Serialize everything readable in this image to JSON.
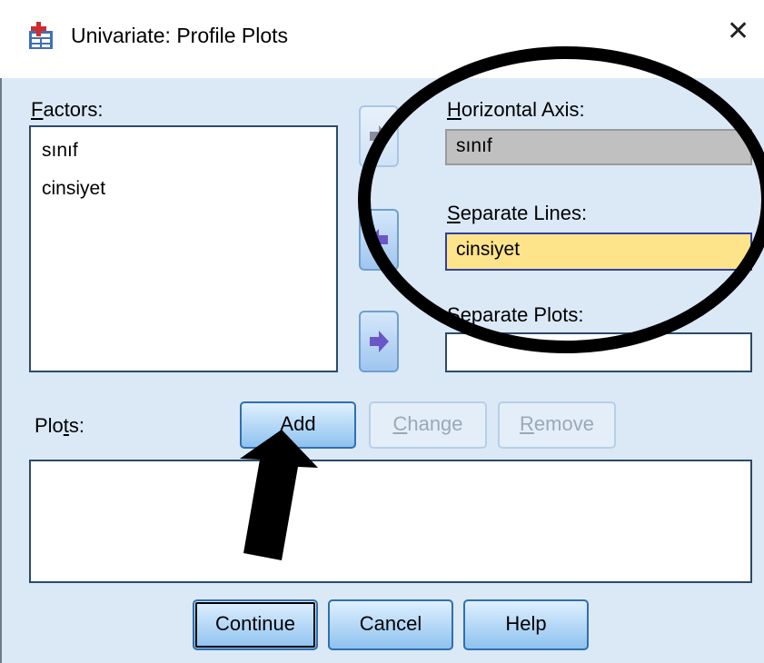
{
  "window": {
    "title": "Univariate: Profile Plots",
    "close_glyph": "✕"
  },
  "factors": {
    "label_ul": "F",
    "label_rest": "actors:",
    "items": [
      "sınıf",
      "cinsiyet"
    ]
  },
  "horizontal_axis": {
    "label_ul": "H",
    "label_rest": "orizontal Axis:",
    "value": "sınıf"
  },
  "separate_lines": {
    "label_ul": "S",
    "label_rest": "eparate Lines:",
    "value": "cinsiyet"
  },
  "separate_plots": {
    "label_ul": "S",
    "label_rest": "eparate Plots:",
    "value": ""
  },
  "plots": {
    "label_pre": "Plo",
    "label_ul": "t",
    "label_rest": "s:"
  },
  "buttons": {
    "add": "Add",
    "change_ul": "C",
    "change_rest": "hange",
    "remove_ul": "R",
    "remove_rest": "emove",
    "continue": "Continue",
    "cancel": "Cancel",
    "help": "Help"
  },
  "colors": {
    "dialog_bg": "#dbe9f7",
    "horizontal_axis_field_bg": "#c0c0c0",
    "separate_lines_field_bg": "#fde38a",
    "arrow_purple": "#6b56c8",
    "annotation": "#000000"
  },
  "icons": {
    "app": "spss-dialog-icon",
    "arrow_right": "arrow-right-icon",
    "arrow_left": "arrow-left-icon"
  }
}
